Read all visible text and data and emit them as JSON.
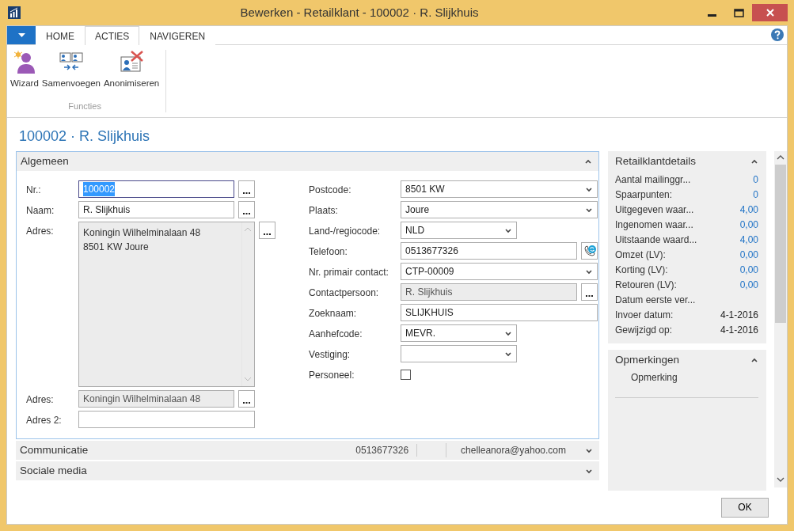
{
  "window": {
    "title": "Bewerken - Retailklant - 100002 · R. Slijkhuis"
  },
  "ribbon": {
    "tabs": [
      {
        "label": "HOME",
        "selected": false
      },
      {
        "label": "ACTIES",
        "selected": true
      },
      {
        "label": "NAVIGEREN",
        "selected": false
      }
    ],
    "groups": [
      {
        "label": "Functies",
        "buttons": [
          {
            "label": "Wizard"
          },
          {
            "label": "Samenvoegen"
          },
          {
            "label": "Anonimiseren"
          }
        ]
      }
    ]
  },
  "page_title": "100002 · R. Slijkhuis",
  "general": {
    "title": "Algemeen",
    "expanded": true,
    "left_fields": [
      {
        "label": "Nr.:",
        "kind": "lookup",
        "value": "100002",
        "disabled": false,
        "focused": true
      },
      {
        "label": "Naam:",
        "kind": "lookup",
        "value": "R. Slijkhuis",
        "disabled": false,
        "focused": false
      },
      {
        "label": "Adres:",
        "kind": "memo",
        "lines": [
          "Koningin Wilhelminalaan 48",
          "8501 KW Joure"
        ],
        "disabled": true,
        "focused": false
      },
      {
        "label": "Adres:",
        "kind": "lookup",
        "value": "Koningin Wilhelminalaan 48",
        "disabled": true,
        "focused": false
      },
      {
        "label": "Adres 2:",
        "kind": "text",
        "disabled": false,
        "focused": false
      }
    ],
    "right_fields": [
      {
        "label": "Postcode:",
        "kind": "combo",
        "value": "8501 KW",
        "disabled": false,
        "focused": false
      },
      {
        "label": "Plaats:",
        "kind": "combo",
        "value": "Joure",
        "disabled": false,
        "focused": false
      },
      {
        "label": "Land-/regiocode:",
        "kind": "short-combo",
        "value": "NLD",
        "disabled": false,
        "focused": false
      },
      {
        "label": "Telefoon:",
        "kind": "phone",
        "value": "0513677326",
        "disabled": false,
        "focused": false
      },
      {
        "label": "Nr. primair contact:",
        "kind": "combo",
        "value": "CTP-00009",
        "disabled": false,
        "focused": false
      },
      {
        "label": "Contactpersoon:",
        "kind": "lookup",
        "value": "R. Slijkhuis",
        "disabled": true,
        "focused": false
      },
      {
        "label": "Zoeknaam:",
        "kind": "text",
        "value": "SLIJKHUIS",
        "disabled": false,
        "focused": false
      },
      {
        "label": "Aanhefcode:",
        "kind": "short-combo",
        "value": "MEVR.",
        "disabled": false,
        "focused": false
      },
      {
        "label": "Vestiging:",
        "kind": "short-combo",
        "disabled": false,
        "focused": false
      },
      {
        "label": "Personeel:",
        "kind": "checkbox",
        "checked": false,
        "disabled": false,
        "focused": false
      }
    ]
  },
  "collapsed_sections": [
    {
      "title": "Communicatie",
      "expanded": false,
      "summary": [
        "0513677326",
        "chelleanora@yahoo.com"
      ]
    },
    {
      "title": "Sociale media",
      "expanded": false
    }
  ],
  "factboxes": [
    {
      "title": "Retailklantdetails",
      "expanded": true,
      "rows": [
        {
          "label": "Aantal mailinggr...",
          "value": "0",
          "link": true
        },
        {
          "label": "Spaarpunten:",
          "value": "0",
          "link": true
        },
        {
          "label": "Uitgegeven waar...",
          "value": "4,00",
          "link": true
        },
        {
          "label": "Ingenomen waar...",
          "value": "0,00",
          "link": true
        },
        {
          "label": "Uitstaande waard...",
          "value": "4,00",
          "link": true
        },
        {
          "label": "Omzet (LV):",
          "value": "0,00",
          "link": true
        },
        {
          "label": "Korting (LV):",
          "value": "0,00",
          "link": true
        },
        {
          "label": "Retouren (LV):",
          "value": "0,00",
          "link": true
        },
        {
          "label": "Datum eerste ver..."
        },
        {
          "label": "Invoer datum:",
          "value": "4-1-2016",
          "link": false
        },
        {
          "label": "Gewijzigd op:",
          "value": "4-1-2016",
          "link": false
        }
      ]
    },
    {
      "title": "Opmerkingen",
      "expanded": true,
      "notes": [
        "Opmerking"
      ]
    }
  ],
  "buttons": [
    "OK"
  ]
}
